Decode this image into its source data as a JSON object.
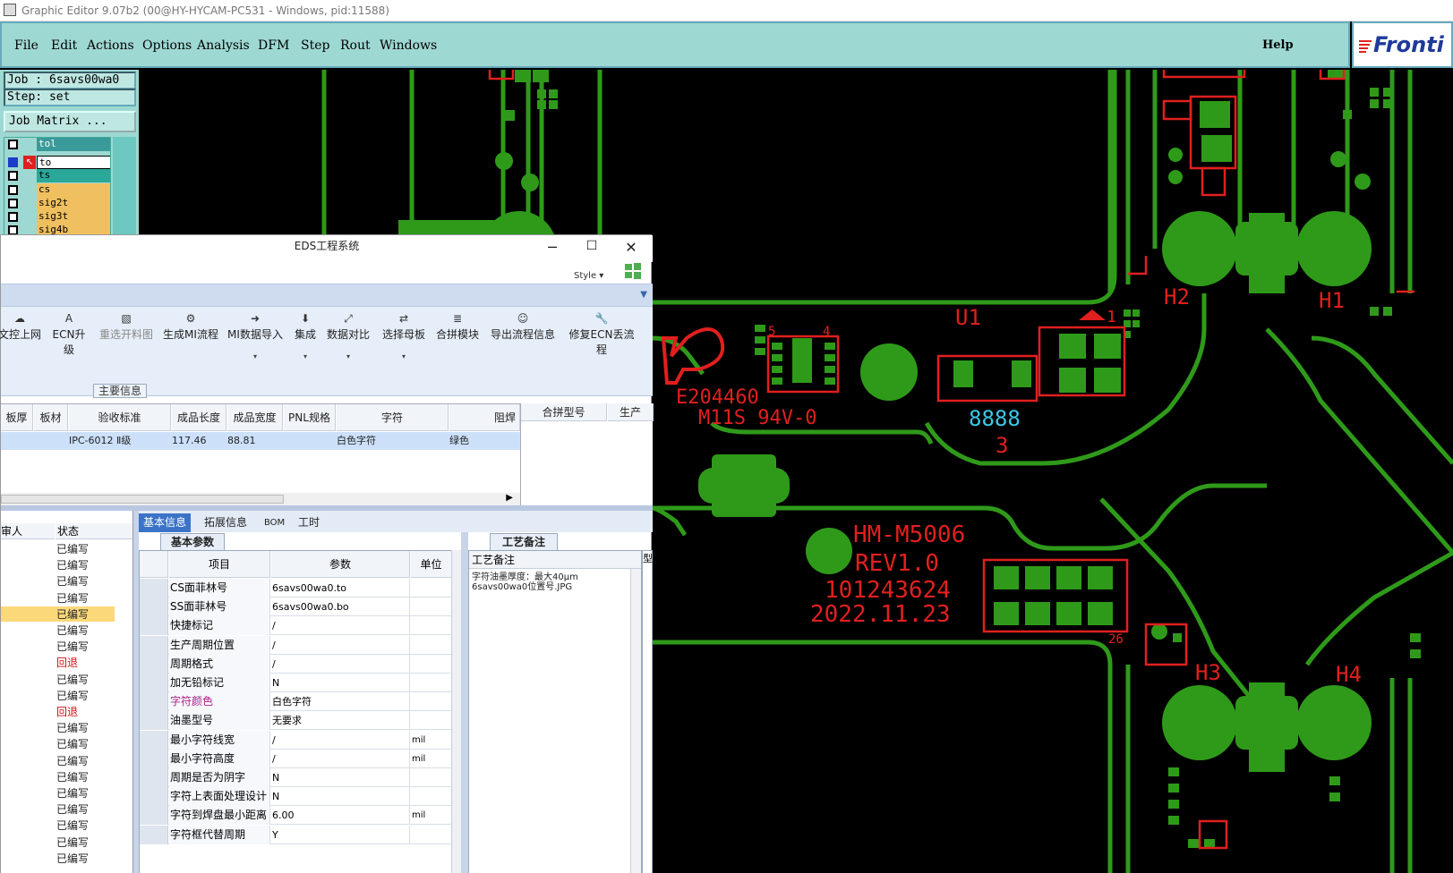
{
  "titlebar": {
    "title": "Graphic Editor 9.07b2 (00@HY-HYCAM-PC531 - Windows, pid:11588)"
  },
  "menu": {
    "items": [
      {
        "label": "File"
      },
      {
        "label": "Edit"
      },
      {
        "label": "Actions"
      },
      {
        "label": "Options"
      },
      {
        "label": "Analysis"
      },
      {
        "label": "DFM"
      },
      {
        "label": "Step"
      },
      {
        "label": "Rout"
      },
      {
        "label": "Windows"
      }
    ],
    "help": "Help",
    "logo_text": "Fronti"
  },
  "job": {
    "job_label": "Job : 6savs00wa0",
    "step_label": "Step: set",
    "matrix_button": "Job Matrix ..."
  },
  "layers": [
    {
      "name": "tol",
      "color": "#40a0a0"
    },
    {
      "name": "to",
      "color": "#ffffff"
    },
    {
      "name": "ts",
      "color": "#2aa89a"
    },
    {
      "name": "cs",
      "color": "#f0c060"
    },
    {
      "name": "sig2t",
      "color": "#f0c060"
    },
    {
      "name": "sig3t",
      "color": "#f0c060"
    },
    {
      "name": "sig4b",
      "color": "#f0c060"
    }
  ],
  "pcb": {
    "silk_texts": [
      "E204460",
      "M11S 94V-0",
      "U1",
      "H2",
      "H1",
      "H3",
      "H4",
      "HM-M5006",
      "REV1.0",
      "101243624",
      "2022.11.23",
      "8888",
      "3",
      "1",
      "26",
      "5",
      "4"
    ],
    "copper_color": "#2f9a1a",
    "silk_color": "#e0201e",
    "cyan_color": "#3cc8e8"
  },
  "eds": {
    "title": "EDS工程系统",
    "style_label": "Style",
    "toolbar": [
      {
        "label": "文控上网",
        "icon": "cloud-upload-icon",
        "dropdown": false,
        "enabled": true
      },
      {
        "label": "ECN升级",
        "icon": "ecn-icon",
        "dropdown": false,
        "enabled": true
      },
      {
        "label": "重选开料图",
        "icon": "image-icon",
        "dropdown": false,
        "enabled": false
      },
      {
        "label": "生成MI流程",
        "icon": "gears-icon",
        "dropdown": false,
        "enabled": true
      },
      {
        "label": "MI数据导入",
        "icon": "import-icon",
        "dropdown": true,
        "enabled": true
      },
      {
        "label": "集成",
        "icon": "download-icon",
        "dropdown": true,
        "enabled": true
      },
      {
        "label": "数据对比",
        "icon": "compare-icon",
        "dropdown": true,
        "enabled": true
      },
      {
        "label": "选择母板",
        "icon": "shuffle-icon",
        "dropdown": true,
        "enabled": true
      },
      {
        "label": "合拼模块",
        "icon": "list-icon",
        "dropdown": false,
        "enabled": true
      },
      {
        "label": "导出流程信息",
        "icon": "smile-icon",
        "dropdown": false,
        "enabled": true
      },
      {
        "label": "修复ECN丢流程",
        "icon": "wrench-icon",
        "dropdown": false,
        "enabled": true
      }
    ],
    "main_info_label": "主要信息",
    "grid1": {
      "headers": [
        "板厚",
        "板材",
        "验收标准",
        "成品长度",
        "成品宽度",
        "PNL规格",
        "字符",
        "阻焊"
      ],
      "row": [
        "",
        "",
        "IPC-6012 Ⅱ级",
        "117.46",
        "88.81",
        "",
        "白色字符",
        "绿色"
      ]
    },
    "grid2": {
      "headers": [
        "合拼型号",
        "生产"
      ]
    },
    "leftlist": {
      "headers": [
        "审人",
        "状态"
      ],
      "items": [
        {
          "status": "已编写",
          "color": "#222222"
        },
        {
          "status": "已编写",
          "color": "#222222"
        },
        {
          "status": "已编写",
          "color": "#222222"
        },
        {
          "status": "已编写",
          "color": "#222222"
        },
        {
          "status": "已编写",
          "color": "#222222",
          "selected": true
        },
        {
          "status": "已编写",
          "color": "#222222"
        },
        {
          "status": "已编写",
          "color": "#222222"
        },
        {
          "status": "回退",
          "color": "#d01010"
        },
        {
          "status": "已编写",
          "color": "#222222"
        },
        {
          "status": "已编写",
          "color": "#222222"
        },
        {
          "status": "回退",
          "color": "#d01010"
        },
        {
          "status": "已编写",
          "color": "#222222"
        },
        {
          "status": "已编写",
          "color": "#222222"
        },
        {
          "status": "已编写",
          "color": "#222222"
        },
        {
          "status": "已编写",
          "color": "#222222"
        },
        {
          "status": "已编写",
          "color": "#222222"
        },
        {
          "status": "已编写",
          "color": "#222222"
        },
        {
          "status": "已编写",
          "color": "#222222"
        },
        {
          "status": "已编写",
          "color": "#222222"
        },
        {
          "status": "已编写",
          "color": "#222222"
        }
      ]
    },
    "tabs": [
      {
        "label": "基本信息",
        "active": true
      },
      {
        "label": "拓展信息"
      },
      {
        "label": "BOM"
      },
      {
        "label": "工时"
      }
    ],
    "subtab_basic": "基本参数",
    "subtab_notes": "工艺备注",
    "params": {
      "headers": [
        "项目",
        "参数",
        "单位"
      ],
      "rows": [
        {
          "item": "CS面菲林号",
          "value": "6savs00wa0.to",
          "unit": "",
          "highlight": false
        },
        {
          "item": "SS面菲林号",
          "value": "6savs00wa0.bo",
          "unit": "",
          "highlight": false
        },
        {
          "item": "快捷标记",
          "value": "/",
          "unit": "",
          "highlight": false
        },
        {
          "item": "生产周期位置",
          "value": "/",
          "unit": "",
          "highlight": false
        },
        {
          "item": "周期格式",
          "value": "/",
          "unit": "",
          "highlight": false
        },
        {
          "item": "加无铅标记",
          "value": "N",
          "unit": "",
          "highlight": false
        },
        {
          "item": "字符颜色",
          "value": "白色字符",
          "unit": "",
          "highlight": true
        },
        {
          "item": "油墨型号",
          "value": "无要求",
          "unit": "",
          "highlight": false
        },
        {
          "item": "最小字符线宽",
          "value": "/",
          "unit": "mil",
          "highlight": false
        },
        {
          "item": "最小字符高度",
          "value": "/",
          "unit": "mil",
          "highlight": false
        },
        {
          "item": "周期是否为阴字",
          "value": "N",
          "unit": "",
          "highlight": false
        },
        {
          "item": "字符上表面处理设计",
          "value": "N",
          "unit": "",
          "highlight": false
        },
        {
          "item": "字符到焊盘最小距离",
          "value": "6.00",
          "unit": "mil",
          "highlight": false
        },
        {
          "item": "字符框代替周期",
          "value": "Y",
          "unit": "",
          "highlight": false
        }
      ],
      "highlight_color": "#b0208a"
    },
    "notes": {
      "header": "工艺备注",
      "text": "字符油墨厚度：最大40μm\n6savs00wa0位置号.JPG",
      "side_header": "型"
    }
  }
}
